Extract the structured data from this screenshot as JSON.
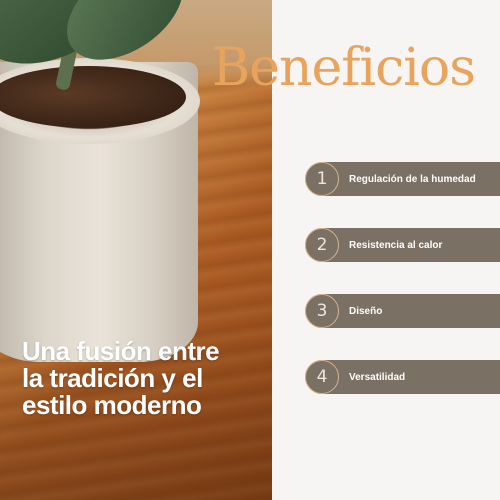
{
  "title": "Beneficios",
  "tagline": "Una fusión entre la tradición y el estilo moderno",
  "benefits": [
    {
      "number": "1",
      "label": "Regulación de la humedad"
    },
    {
      "number": "2",
      "label": "Resistencia al calor"
    },
    {
      "number": "3",
      "label": "Diseño"
    },
    {
      "number": "4",
      "label": "Versatilidad"
    }
  ],
  "colors": {
    "title": "#e8a45c",
    "pill": "#7a7064",
    "number_ring": "#d8b48a",
    "background": "#f6f5f3"
  },
  "icons": {
    "photo": "plant-pot-photo"
  }
}
